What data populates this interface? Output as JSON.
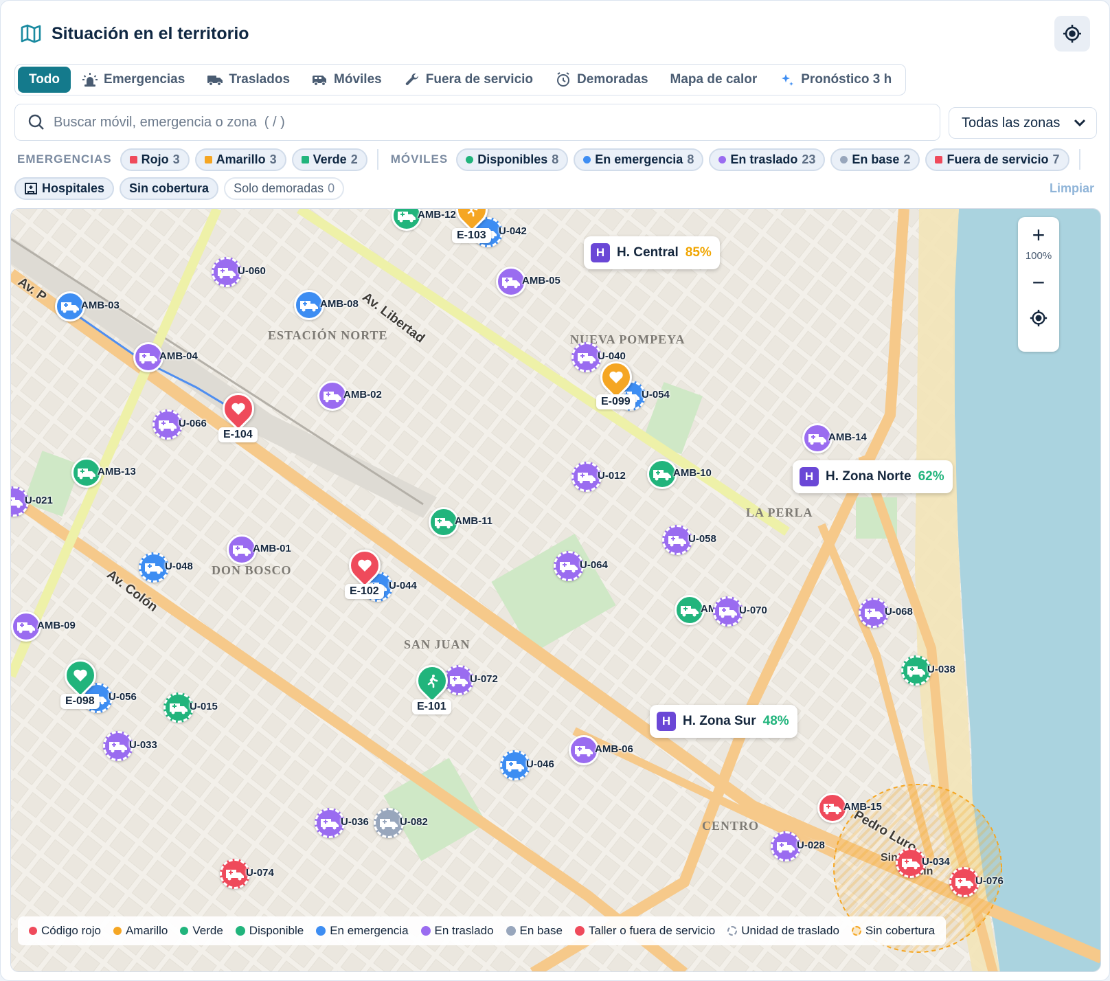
{
  "header": {
    "title": "Situación en el territorio",
    "icon": "map-icon",
    "locate_icon": "crosshair-icon"
  },
  "tabs": [
    {
      "label": "Todo",
      "icon": "",
      "active": true
    },
    {
      "label": "Emergencias",
      "icon": "siren-icon"
    },
    {
      "label": "Traslados",
      "icon": "truck-icon"
    },
    {
      "label": "Móviles",
      "icon": "van-icon"
    },
    {
      "label": "Fuera de servicio",
      "icon": "wrench-icon"
    },
    {
      "label": "Demoradas",
      "icon": "alarm-clock-icon"
    },
    {
      "label": "Mapa de calor",
      "icon": ""
    },
    {
      "label": "Pronóstico 3 h",
      "icon": "sparkle-icon"
    }
  ],
  "search": {
    "placeholder": "Buscar móvil, emergencia o zona  ( / )",
    "value": ""
  },
  "zone_select": {
    "value": "Todas las zonas"
  },
  "filters": {
    "emergencias_label": "EMERGENCIAS",
    "moviles_label": "MÓVILES",
    "emergencias": [
      {
        "label": "Rojo",
        "count": "3",
        "color": "#ef4a5b"
      },
      {
        "label": "Amarillo",
        "count": "3",
        "color": "#f5a623"
      },
      {
        "label": "Verde",
        "count": "2",
        "color": "#21b47c"
      }
    ],
    "moviles": [
      {
        "label": "Disponibles",
        "count": "8",
        "color": "#21b47c"
      },
      {
        "label": "En emergencia",
        "count": "8",
        "color": "#3d8df2"
      },
      {
        "label": "En traslado",
        "count": "23",
        "color": "#9a6cf0"
      },
      {
        "label": "En base",
        "count": "2",
        "color": "#98a6bc"
      },
      {
        "label": "Fuera de servicio",
        "count": "7",
        "color": "#ef4a5b"
      }
    ],
    "hospitales": "Hospitales",
    "sin_cobertura": "Sin cobertura",
    "solo_demoradas": "Solo demoradas",
    "solo_demoradas_count": "0",
    "clear": "Limpiar"
  },
  "map": {
    "areas": [
      "ESTACIÓN NORTE",
      "NUEVA POMPEYA",
      "LA PERLA",
      "DON BOSCO",
      "SAN JUAN",
      "CENTRO"
    ],
    "streets": [
      "Av. Libertad",
      "Av. Colón",
      "Av. P",
      "Luro",
      "Pedro Luro"
    ],
    "zoom_pct": "100%",
    "hospitals": [
      {
        "name": "H. Central",
        "load": "85%",
        "load_color": "#f0a500"
      },
      {
        "name": "H. Zona Norte",
        "load": "62%",
        "load_color": "#21b47c"
      },
      {
        "name": "H. Zona Sur",
        "load": "48%",
        "load_color": "#21b47c"
      }
    ],
    "emergencies": [
      {
        "id": "E-103",
        "level": "amarillo",
        "icon": "runner-icon"
      },
      {
        "id": "E-099",
        "level": "amarillo",
        "icon": "heart-icon"
      },
      {
        "id": "E-104",
        "level": "rojo",
        "icon": "heart-icon"
      },
      {
        "id": "E-102",
        "level": "rojo",
        "icon": "heart-icon"
      },
      {
        "id": "E-098",
        "level": "verde",
        "icon": "heart-icon"
      },
      {
        "id": "E-101",
        "level": "verde",
        "icon": "runner-icon"
      }
    ],
    "units": [
      {
        "id": "AMB-12",
        "status": "disponible"
      },
      {
        "id": "U-042",
        "status": "emergencia"
      },
      {
        "id": "U-060",
        "status": "traslado"
      },
      {
        "id": "AMB-05",
        "status": "traslado"
      },
      {
        "id": "AMB-03",
        "status": "emergencia"
      },
      {
        "id": "AMB-08",
        "status": "emergencia"
      },
      {
        "id": "AMB-04",
        "status": "traslado"
      },
      {
        "id": "U-040",
        "status": "traslado"
      },
      {
        "id": "U-054",
        "status": "emergencia"
      },
      {
        "id": "AMB-02",
        "status": "traslado"
      },
      {
        "id": "U-066",
        "status": "traslado"
      },
      {
        "id": "AMB-14",
        "status": "traslado"
      },
      {
        "id": "AMB-13",
        "status": "disponible"
      },
      {
        "id": "U-012",
        "status": "traslado"
      },
      {
        "id": "AMB-10",
        "status": "disponible"
      },
      {
        "id": "U-021",
        "status": "traslado"
      },
      {
        "id": "AMB-11",
        "status": "disponible"
      },
      {
        "id": "U-058",
        "status": "traslado"
      },
      {
        "id": "AMB-01",
        "status": "traslado"
      },
      {
        "id": "U-048",
        "status": "emergencia"
      },
      {
        "id": "U-064",
        "status": "traslado"
      },
      {
        "id": "U-044",
        "status": "emergencia"
      },
      {
        "id": "AM",
        "status": "disponible"
      },
      {
        "id": "U-070",
        "status": "traslado"
      },
      {
        "id": "U-068",
        "status": "traslado"
      },
      {
        "id": "AMB-09",
        "status": "traslado"
      },
      {
        "id": "U-038",
        "status": "disponible"
      },
      {
        "id": "U-072",
        "status": "traslado"
      },
      {
        "id": "U-056",
        "status": "emergencia"
      },
      {
        "id": "U-015",
        "status": "disponible"
      },
      {
        "id": "U-033",
        "status": "traslado"
      },
      {
        "id": "AMB-06",
        "status": "traslado"
      },
      {
        "id": "U-046",
        "status": "emergencia"
      },
      {
        "id": "AMB-15",
        "status": "fuera"
      },
      {
        "id": "U-036",
        "status": "traslado"
      },
      {
        "id": "U-082",
        "status": "base"
      },
      {
        "id": "U-028",
        "status": "traslado"
      },
      {
        "id": "U-034",
        "status": "fuera"
      },
      {
        "id": "U-074",
        "status": "fuera"
      },
      {
        "id": "U-076",
        "status": "fuera"
      }
    ],
    "no_coverage_label_1": "Sin",
    "no_coverage_label_2": "a",
    "no_coverage_time": "min"
  },
  "legend": [
    {
      "label": "Código rojo",
      "color": "#ef4a5b"
    },
    {
      "label": "Amarillo",
      "color": "#f5a623"
    },
    {
      "label": "Verde",
      "color": "#21b47c"
    },
    {
      "label": "Disponible",
      "color": "#21b47c"
    },
    {
      "label": "En emergencia",
      "color": "#3d8df2"
    },
    {
      "label": "En traslado",
      "color": "#9a6cf0"
    },
    {
      "label": "En base",
      "color": "#98a6bc"
    },
    {
      "label": "Taller o fuera de servicio",
      "color": "#ef4a5b"
    },
    {
      "label": "Unidad de traslado",
      "color": "#8a96aa"
    },
    {
      "label": "Sin cobertura",
      "color": "#f5a623"
    }
  ]
}
